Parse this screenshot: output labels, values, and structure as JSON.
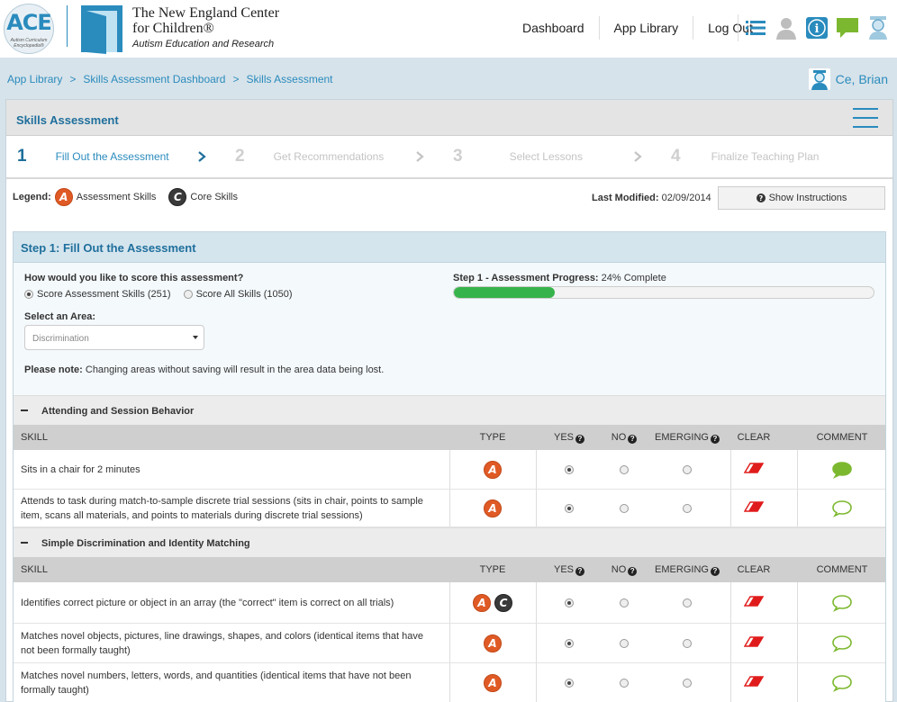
{
  "header": {
    "ace_logo_text": "ACE",
    "ace_logo_sub": "Autism Curriculum Encyclopedia®",
    "org_line1": "The New England Center",
    "org_line2": "for Children®",
    "org_line3": "Autism Education and Research",
    "nav": [
      "Dashboard",
      "App Library",
      "Log Out"
    ],
    "icons": [
      "list-icon",
      "user-silhouette-icon",
      "info-icon",
      "chat-icon",
      "student-icon"
    ],
    "accent": "#2a8bbd"
  },
  "breadcrumb": {
    "items": [
      "App Library",
      "Skills Assessment Dashboard",
      "Skills Assessment"
    ],
    "sep": ">"
  },
  "user": {
    "name": "Ce, Brian"
  },
  "panel": {
    "title": "Skills Assessment"
  },
  "steps": [
    {
      "num": "1",
      "label": "Fill Out the Assessment"
    },
    {
      "num": "2",
      "label": "Get Recommendations"
    },
    {
      "num": "3",
      "label": "Select Lessons"
    },
    {
      "num": "4",
      "label": "Finalize Teaching Plan"
    }
  ],
  "legend": {
    "label": "Legend:",
    "a_badge": "A",
    "a_label": "Assessment Skills",
    "c_badge": "C",
    "c_label": "Core Skills"
  },
  "last_modified": {
    "label": "Last Modified:",
    "value": "02/09/2014"
  },
  "instructions_button": "Show Instructions",
  "step1": {
    "title": "Step 1: Fill Out the Assessment",
    "question": "How would you like to score this assessment?",
    "option1": "Score Assessment Skills (251)",
    "option2": "Score All Skills (1050)",
    "select_label": "Select an Area:",
    "select_value": "Discrimination",
    "note_bold": "Please note:",
    "note_text": "Changing areas without saving will result in the area data being lost.",
    "progress_label": "Step 1 - Assessment Progress:",
    "progress_text": "24% Complete",
    "progress_fraction": 0.24,
    "progress_color": "#36b34a"
  },
  "table_headers": [
    "SKILL",
    "TYPE",
    "YES",
    "NO",
    "EMERGING",
    "CLEAR",
    "COMMENT"
  ],
  "sections": [
    {
      "title": "Attending and Session Behavior",
      "rows": [
        {
          "skill": "Sits in a chair for 2 minutes",
          "types": [
            "A"
          ],
          "value": "yes",
          "comment": "filled"
        },
        {
          "skill": "Attends to task during match-to-sample discrete trial sessions (sits in chair, points to sample item, scans all materials, and points to materials during discrete trial sessions)",
          "types": [
            "A"
          ],
          "value": "yes",
          "comment": "empty"
        }
      ]
    },
    {
      "title": "Simple Discrimination and Identity Matching",
      "rows": [
        {
          "skill": "Identifies correct picture or object in an array (the \"correct\" item is correct on all trials)",
          "types": [
            "A",
            "C"
          ],
          "value": "yes",
          "comment": "empty"
        },
        {
          "skill": "Matches novel objects, pictures, line drawings, shapes, and colors (identical items that have not been formally taught)",
          "types": [
            "A"
          ],
          "value": "yes",
          "comment": "empty"
        },
        {
          "skill": "Matches novel numbers, letters, words, and quantities (identical items that have not been formally taught)",
          "types": [
            "A"
          ],
          "value": "yes",
          "comment": "empty"
        }
      ]
    }
  ]
}
